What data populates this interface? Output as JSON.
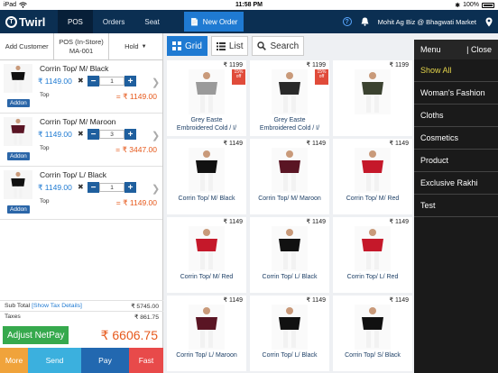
{
  "status_bar": {
    "device": "iPad",
    "time": "11:58 PM",
    "battery": "100%"
  },
  "topnav": {
    "logo": "Twirl",
    "tabs": [
      "POS",
      "Orders",
      "Seat"
    ],
    "new_order": "New Order",
    "store": "Mohit Ag Biz @ Bhagwati Market"
  },
  "left_tabs": {
    "customer": "Add Customer",
    "pos_line1": "POS (In-Store)",
    "pos_line2": "MA-001",
    "hold": "Hold"
  },
  "cart": [
    {
      "name": "Corrin Top/ M/ Black",
      "price": "₹ 1149.00",
      "qty": "1",
      "category": "Top",
      "total": "= ₹ 1149.00",
      "addon": "Addon",
      "color": "#111111"
    },
    {
      "name": "Corrin Top/ M/ Maroon",
      "price": "₹ 1149.00",
      "qty": "3",
      "category": "Top",
      "total": "= ₹ 3447.00",
      "addon": "Addon",
      "color": "#5a1524"
    },
    {
      "name": "Corrin Top/ L/ Black",
      "price": "₹ 1149.00",
      "qty": "1",
      "category": "Top",
      "total": "= ₹ 1149.00",
      "addon": "Addon",
      "color": "#111111"
    }
  ],
  "totals": {
    "subtotal_label": "Sub Total",
    "tax_link": "[Show Tax Details]",
    "subtotal": "₹ 5745.00",
    "taxes_label": "Taxes",
    "taxes": "₹ 861.75",
    "net_button": "Adjust NetPay",
    "net": "₹ 6606.75"
  },
  "actions": [
    {
      "label": "More",
      "color": "#f0a33b"
    },
    {
      "label": "Send",
      "color": "#3bb0de"
    },
    {
      "label": "Pay",
      "color": "#2268b0"
    },
    {
      "label": "Fast",
      "color": "#e84a4a"
    }
  ],
  "view": {
    "grid": "Grid",
    "list": "List",
    "search": "Search"
  },
  "products": [
    {
      "price": "₹ 1199",
      "line1": "Grey Easte",
      "line2": "Embroidered Cold / I/",
      "badge": "15% off",
      "color": "#9a9a9a"
    },
    {
      "price": "₹ 1199",
      "line1": "Grey Easte",
      "line2": "Embroidered Cold / I/",
      "badge": "15% off",
      "color": "#2a2a2a"
    },
    {
      "price": "₹ 1199",
      "line1": "",
      "line2": "",
      "badge": "",
      "color": "#3b4230"
    },
    {
      "price": "₹ 1149",
      "line1": "Corrin Top/ M/ Black",
      "line2": "",
      "badge": "",
      "color": "#111111"
    },
    {
      "price": "₹ 1149",
      "line1": "Corrin Top/ M/ Maroon",
      "line2": "",
      "badge": "",
      "color": "#5a1524"
    },
    {
      "price": "₹ 1149",
      "line1": "Corrin Top/ M/ Red",
      "line2": "",
      "badge": "",
      "color": "#c5182a"
    },
    {
      "price": "₹ 1149",
      "line1": "Corrin Top/ M/ Red",
      "line2": "",
      "badge": "",
      "color": "#c5182a"
    },
    {
      "price": "₹ 1149",
      "line1": "Corrin Top/ L/ Black",
      "line2": "",
      "badge": "",
      "color": "#111111"
    },
    {
      "price": "₹ 1149",
      "line1": "Corrin Top/ L/ Red",
      "line2": "",
      "badge": "",
      "color": "#c5182a"
    },
    {
      "price": "₹ 1149",
      "line1": "Corrin Top/ L/ Maroon",
      "line2": "",
      "badge": "",
      "color": "#5a1524"
    },
    {
      "price": "₹ 1149",
      "line1": "Corrin Top/ L/ Black",
      "line2": "",
      "badge": "",
      "color": "#111111"
    },
    {
      "price": "₹ 1149",
      "line1": "Corrin Top/ S/ Black",
      "line2": "",
      "badge": "",
      "color": "#111111"
    }
  ],
  "menu": {
    "title": "Menu",
    "close": "Close",
    "items": [
      "Show All",
      "Woman's Fashion",
      "Cloths",
      "Cosmetics",
      "Product",
      "Exclusive Rakhi",
      "Test"
    ],
    "selected_color": "#e4d44b"
  }
}
